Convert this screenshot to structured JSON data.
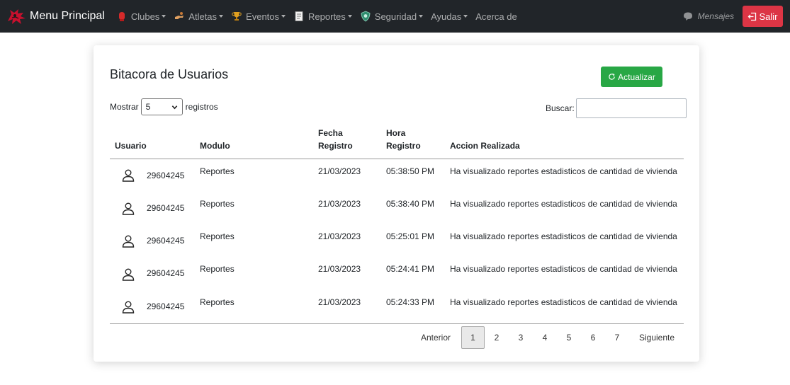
{
  "navbar": {
    "brand": "Menu Principal",
    "items": [
      {
        "label": "Clubes",
        "icon": "boxing-glove-icon",
        "dropdown": true
      },
      {
        "label": "Atletas",
        "icon": "athlete-icon",
        "dropdown": true
      },
      {
        "label": "Eventos",
        "icon": "trophy-icon",
        "dropdown": true
      },
      {
        "label": "Reportes",
        "icon": "report-document-icon",
        "dropdown": true
      },
      {
        "label": "Seguridad",
        "icon": "shield-icon",
        "dropdown": true
      },
      {
        "label": "Ayudas",
        "icon": "",
        "dropdown": true
      },
      {
        "label": "Acerca de",
        "icon": "",
        "dropdown": false
      }
    ],
    "messages_label": "Mensajes",
    "logout_label": "Salir"
  },
  "card": {
    "title": "Bitacora de Usuarios",
    "refresh_label": "Actualizar",
    "show_prefix": "Mostrar",
    "show_value": "5",
    "show_suffix": "registros",
    "search_label": "Buscar:",
    "search_value": ""
  },
  "table": {
    "headers": {
      "usuario": "Usuario",
      "modulo": "Modulo",
      "fecha_1": "Fecha",
      "fecha_2": "Registro",
      "hora_1": "Hora",
      "hora_2": "Registro",
      "accion": "Accion Realizada"
    },
    "rows": [
      {
        "usuario": "29604245",
        "modulo": "Reportes",
        "fecha": "21/03/2023",
        "hora": "05:38:50 PM",
        "accion": "Ha visualizado reportes estadisticos de cantidad de vivienda"
      },
      {
        "usuario": "29604245",
        "modulo": "Reportes",
        "fecha": "21/03/2023",
        "hora": "05:38:40 PM",
        "accion": "Ha visualizado reportes estadisticos de cantidad de vivienda"
      },
      {
        "usuario": "29604245",
        "modulo": "Reportes",
        "fecha": "21/03/2023",
        "hora": "05:25:01 PM",
        "accion": "Ha visualizado reportes estadisticos de cantidad de vivienda"
      },
      {
        "usuario": "29604245",
        "modulo": "Reportes",
        "fecha": "21/03/2023",
        "hora": "05:24:41 PM",
        "accion": "Ha visualizado reportes estadisticos de cantidad de vivienda"
      },
      {
        "usuario": "29604245",
        "modulo": "Reportes",
        "fecha": "21/03/2023",
        "hora": "05:24:33 PM",
        "accion": "Ha visualizado reportes estadisticos de cantidad de vivienda"
      }
    ]
  },
  "pagination": {
    "prev": "Anterior",
    "pages": [
      "1",
      "2",
      "3",
      "4",
      "5",
      "6",
      "7"
    ],
    "active": "1",
    "next": "Siguiente"
  },
  "colors": {
    "navbar_bg": "#212529",
    "logout_btn": "#dc3545",
    "refresh_btn": "#28a745"
  }
}
